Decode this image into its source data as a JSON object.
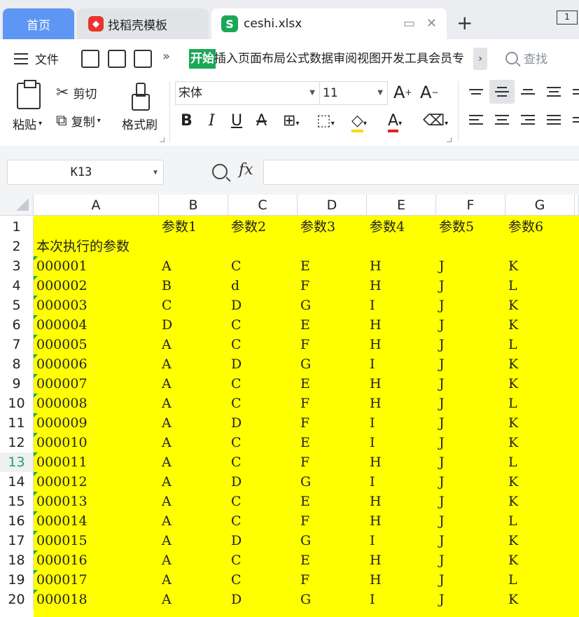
{
  "tabs": {
    "home": "首页",
    "template": "找稻壳模板",
    "file": "ceshi.xlsx",
    "window_badge": "1"
  },
  "menu": {
    "file": "文件",
    "active_tab": "开始",
    "tabs": [
      "插入",
      "页面布局",
      "公式",
      "数据",
      "审阅",
      "视图",
      "开发工具",
      "会员专"
    ],
    "more_arrow": "›",
    "search": "查找"
  },
  "ribbon": {
    "paste": "粘贴",
    "cut": "剪切",
    "copy": "复制",
    "format_painter": "格式刷",
    "font_name": "宋体",
    "font_size": "11"
  },
  "formula": {
    "name_box": "K13",
    "fx": "fx",
    "value": ""
  },
  "sheet": {
    "columns": [
      "A",
      "B",
      "C",
      "D",
      "E",
      "F",
      "G"
    ],
    "active_row": 13,
    "rows": [
      {
        "n": "1",
        "cells": [
          "",
          "参数1",
          "参数2",
          "参数3",
          "参数4",
          "参数5",
          "参数6"
        ]
      },
      {
        "n": "2",
        "cells": [
          "本次执行的参数",
          "",
          "",
          "",
          "",
          "",
          ""
        ]
      },
      {
        "n": "3",
        "cells": [
          "000001",
          "A",
          "C",
          "E",
          "H",
          "J",
          "K"
        ]
      },
      {
        "n": "4",
        "cells": [
          "000002",
          "B",
          "d",
          "F",
          "H",
          "J",
          "L"
        ]
      },
      {
        "n": "5",
        "cells": [
          "000003",
          "C",
          "D",
          "G",
          "I",
          "J",
          "K"
        ]
      },
      {
        "n": "6",
        "cells": [
          "000004",
          "D",
          "C",
          "E",
          "H",
          "J",
          "K"
        ]
      },
      {
        "n": "7",
        "cells": [
          "000005",
          "A",
          "C",
          "F",
          "H",
          "J",
          "L"
        ]
      },
      {
        "n": "8",
        "cells": [
          "000006",
          "A",
          "D",
          "G",
          "I",
          "J",
          "K"
        ]
      },
      {
        "n": "9",
        "cells": [
          "000007",
          "A",
          "C",
          "E",
          "H",
          "J",
          "K"
        ]
      },
      {
        "n": "10",
        "cells": [
          "000008",
          "A",
          "C",
          "F",
          "H",
          "J",
          "L"
        ]
      },
      {
        "n": "11",
        "cells": [
          "000009",
          "A",
          "D",
          "F",
          "I",
          "J",
          "K"
        ]
      },
      {
        "n": "12",
        "cells": [
          "000010",
          "A",
          "C",
          "E",
          "I",
          "J",
          "K"
        ]
      },
      {
        "n": "13",
        "cells": [
          "000011",
          "A",
          "C",
          "F",
          "H",
          "J",
          "L"
        ]
      },
      {
        "n": "14",
        "cells": [
          "000012",
          "A",
          "D",
          "G",
          "I",
          "J",
          "K"
        ]
      },
      {
        "n": "15",
        "cells": [
          "000013",
          "A",
          "C",
          "E",
          "H",
          "J",
          "K"
        ]
      },
      {
        "n": "16",
        "cells": [
          "000014",
          "A",
          "C",
          "F",
          "H",
          "J",
          "L"
        ]
      },
      {
        "n": "17",
        "cells": [
          "000015",
          "A",
          "D",
          "G",
          "I",
          "J",
          "K"
        ]
      },
      {
        "n": "18",
        "cells": [
          "000016",
          "A",
          "C",
          "E",
          "H",
          "J",
          "K"
        ]
      },
      {
        "n": "19",
        "cells": [
          "000017",
          "A",
          "C",
          "F",
          "H",
          "J",
          "L"
        ]
      },
      {
        "n": "20",
        "cells": [
          "000018",
          "A",
          "D",
          "G",
          "I",
          "J",
          "K"
        ]
      }
    ]
  },
  "colors": {
    "fill": "#ffff00",
    "accent": "#1ba856",
    "home_tab": "#5e96f3"
  }
}
